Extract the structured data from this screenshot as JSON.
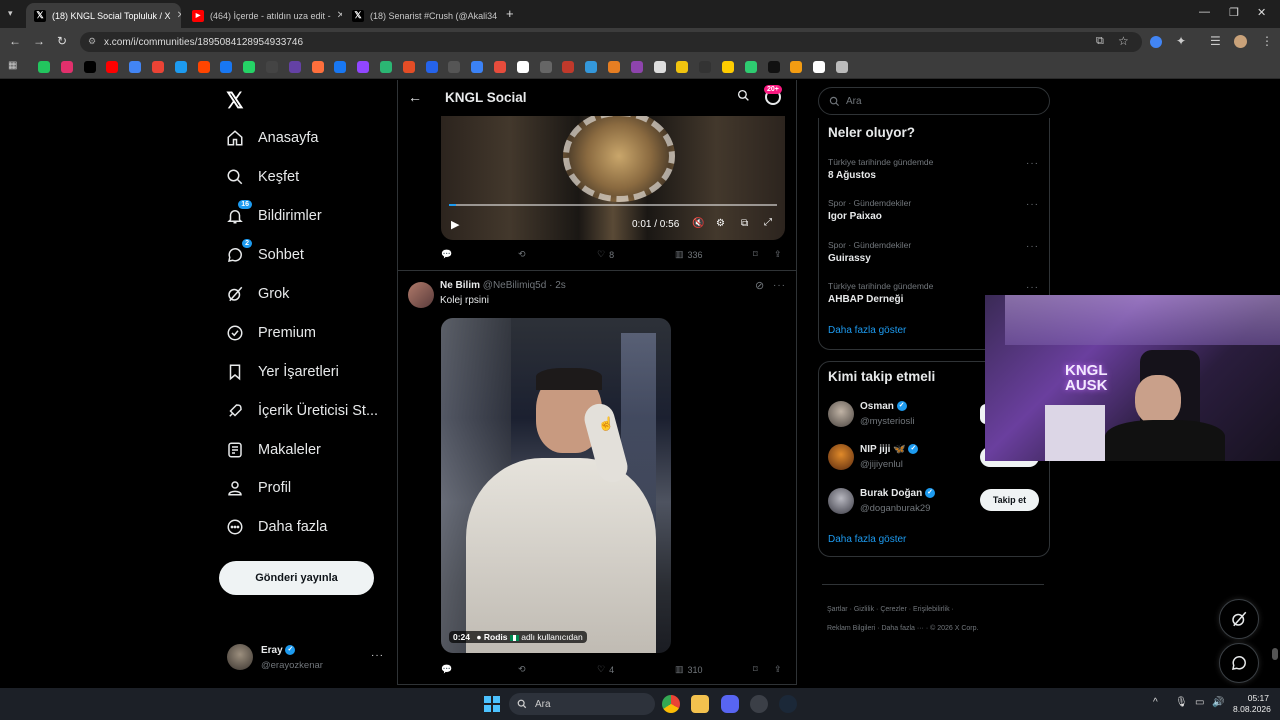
{
  "browser": {
    "tabs": [
      {
        "title": "(18) KNGL Social Topluluk / X",
        "icon": "x-icon",
        "active": true
      },
      {
        "title": "(464) İçerde - atıldın uza edit -",
        "icon": "youtube-icon",
        "active": false
      },
      {
        "title": "(18) Senarist #Crush (@Akali34",
        "icon": "x-icon",
        "active": false
      }
    ],
    "url": "x.com/i/communities/1895084128954933746"
  },
  "nav": {
    "items": [
      {
        "label": "Anasayfa",
        "icon": "home-icon"
      },
      {
        "label": "Keşfet",
        "icon": "search-icon"
      },
      {
        "label": "Bildirimler",
        "icon": "bell-icon",
        "badge": "16"
      },
      {
        "label": "Sohbet",
        "icon": "chat-icon",
        "badge": "2"
      },
      {
        "label": "Grok",
        "icon": "grok-icon"
      },
      {
        "label": "Premium",
        "icon": "premium-icon"
      },
      {
        "label": "Yer İşaretleri",
        "icon": "bookmark-icon"
      },
      {
        "label": "İçerik Üreticisi St...",
        "icon": "rocket-icon"
      },
      {
        "label": "Makaleler",
        "icon": "article-icon"
      },
      {
        "label": "Profil",
        "icon": "person-icon"
      },
      {
        "label": "Daha fazla",
        "icon": "more-circle-icon"
      }
    ],
    "post_button": "Gönderi yayınla",
    "account": {
      "name": "Eray",
      "handle": "@erayozkenar"
    }
  },
  "header": {
    "title": "KNGL Social",
    "notif_badge": "20+"
  },
  "post1": {
    "video_time": "0:01 / 0:56",
    "likes": "8",
    "views": "336"
  },
  "post2": {
    "author": "Ne Bilim",
    "handle": "@NeBilimiq5d",
    "time": "2s",
    "text": "Kolej rpsini",
    "video_duration": "0:24",
    "video_credit_user": "Rodis",
    "video_credit_suffix": "adlı kullanıcıdan",
    "likes": "4",
    "views": "310"
  },
  "sidebar": {
    "search_placeholder": "Ara",
    "trends_title": "Neler oluyor?",
    "trends": [
      {
        "meta": "Türkiye tarihinde gündemde",
        "name": "8 Ağustos"
      },
      {
        "meta": "Spor · Gündemdekiler",
        "name": "Igor Paixao"
      },
      {
        "meta": "Spor · Gündemdekiler",
        "name": "Guirassy"
      },
      {
        "meta": "Türkiye tarihinde gündemde",
        "name": "AHBAP Derneği"
      }
    ],
    "trends_more": "Daha fazla göster",
    "who_title": "Kimi takip etmeli",
    "who": [
      {
        "name": "Osman",
        "handle": "@mysteriosli"
      },
      {
        "name": "NIP jiji 🦋",
        "handle": "@jijiyenlul"
      },
      {
        "name": "Burak Doğan",
        "handle": "@doganburak29",
        "button": "Takip et"
      }
    ],
    "who_more": "Daha fazla göster",
    "footer": [
      "Şartlar",
      "Gizlilik",
      "Çerezler",
      "Erişilebilirlik",
      "Reklam Bilgileri",
      "Daha fazla ···",
      "© 2026 X Corp."
    ]
  },
  "webcam": {
    "neon_text": "KNGL\nAUSK"
  },
  "taskbar": {
    "search": "Ara",
    "time": "05:17",
    "date": "8.08.2026"
  }
}
